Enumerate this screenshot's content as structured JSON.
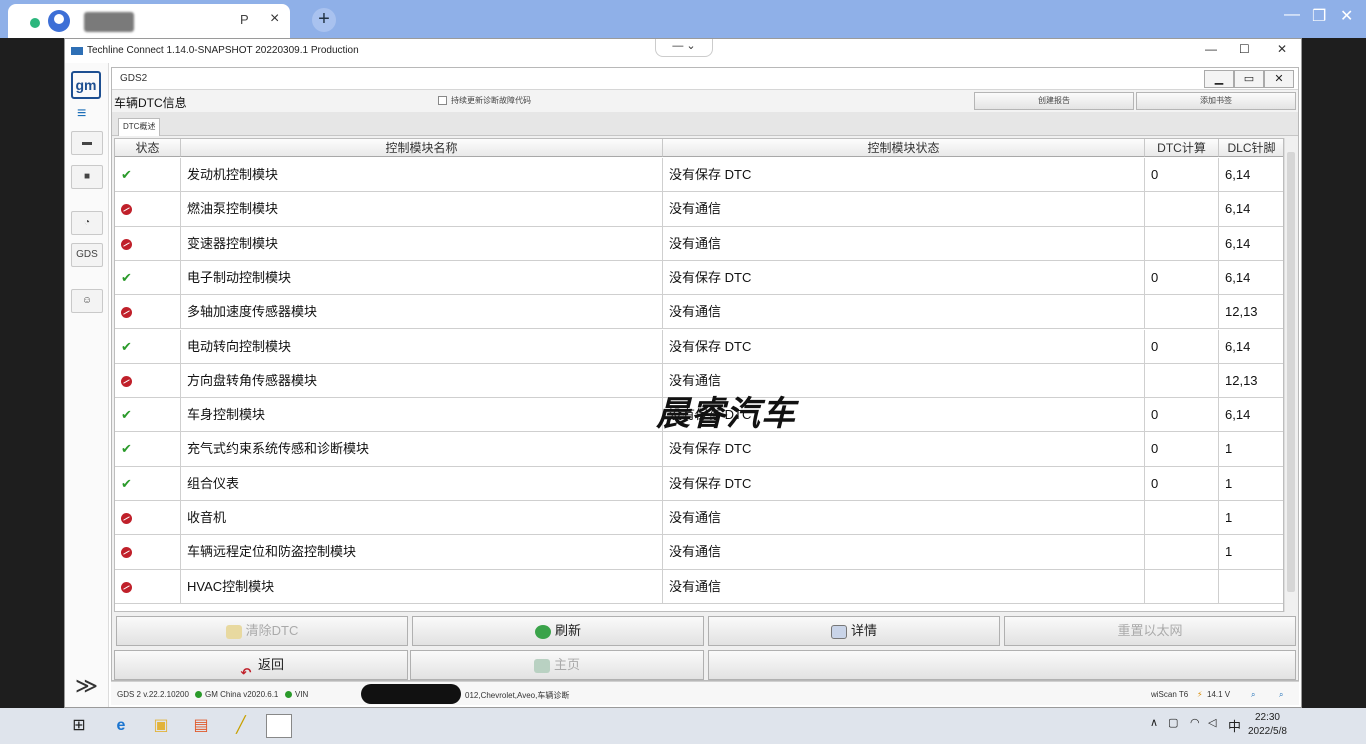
{
  "browser": {
    "tab_text": "P",
    "tab_close": "×",
    "new_tab": "+",
    "min": "—",
    "restore": "❐",
    "close": "✕"
  },
  "app": {
    "title": "Techline Connect 1.14.0-SNAPSHOT 20220309.1 Production",
    "title_min": "—",
    "title_max": "☐",
    "title_close": "✕",
    "dropdown": "— ⌄"
  },
  "sidebar": {
    "logo": "gm",
    "gds_label": "GDS",
    "expand": "≫"
  },
  "gds": {
    "window_title": "GDS2",
    "ctl_min": "▁",
    "ctl_max": "▭",
    "ctl_close": "✕",
    "page_heading": "车辆DTC信息",
    "checkbox_label": "持续更新诊断故障代码",
    "btn_create_report": "创建报告",
    "btn_add_marker": "添加书签",
    "subtab": "DTC概述"
  },
  "table": {
    "columns": [
      "状态",
      "控制模块名称",
      "控制模块状态",
      "DTC计算",
      "DLC针脚"
    ],
    "rows": [
      {
        "status": "ok",
        "name": "发动机控制模块",
        "state": "没有保存 DTC",
        "dtc": "0",
        "dlc": "6,14"
      },
      {
        "status": "err",
        "name": "燃油泵控制模块",
        "state": "没有通信",
        "dtc": "",
        "dlc": "6,14"
      },
      {
        "status": "err",
        "name": "变速器控制模块",
        "state": "没有通信",
        "dtc": "",
        "dlc": "6,14"
      },
      {
        "status": "ok",
        "name": "电子制动控制模块",
        "state": "没有保存 DTC",
        "dtc": "0",
        "dlc": "6,14"
      },
      {
        "status": "err",
        "name": "多轴加速度传感器模块",
        "state": "没有通信",
        "dtc": "",
        "dlc": "12,13"
      },
      {
        "status": "ok",
        "name": "电动转向控制模块",
        "state": "没有保存 DTC",
        "dtc": "0",
        "dlc": "6,14"
      },
      {
        "status": "err",
        "name": "方向盘转角传感器模块",
        "state": "没有通信",
        "dtc": "",
        "dlc": "12,13"
      },
      {
        "status": "ok",
        "name": "车身控制模块",
        "state": "没有保存 DTC",
        "dtc": "0",
        "dlc": "6,14"
      },
      {
        "status": "ok",
        "name": "充气式约束系统传感和诊断模块",
        "state": "没有保存 DTC",
        "dtc": "0",
        "dlc": "1"
      },
      {
        "status": "ok",
        "name": "组合仪表",
        "state": "没有保存 DTC",
        "dtc": "0",
        "dlc": "1"
      },
      {
        "status": "err",
        "name": "收音机",
        "state": "没有通信",
        "dtc": "",
        "dlc": "1"
      },
      {
        "status": "err",
        "name": "车辆远程定位和防盗控制模块",
        "state": "没有通信",
        "dtc": "",
        "dlc": "1"
      },
      {
        "status": "err",
        "name": "HVAC控制模块",
        "state": "没有通信",
        "dtc": "",
        "dlc": ""
      }
    ]
  },
  "watermark": "晨睿汽车",
  "buttons": {
    "clear_dtc": "清除DTC",
    "refresh": "刷新",
    "details": "详情",
    "ethernet": "重置以太网",
    "back": "返回",
    "home": "主页"
  },
  "statusbar": {
    "version": "GDS 2 v.22.2.10200",
    "gm_china": "GM China v2020.6.1",
    "vin_label": "VIN",
    "vehicle": "012,Chevrolet,Aveo,车辆诊断",
    "wiscan": "wiScan T6",
    "voltage": "14.1 V"
  },
  "taskbar": {
    "ime": "中",
    "time": "22:30",
    "date": "2022/5/8"
  }
}
